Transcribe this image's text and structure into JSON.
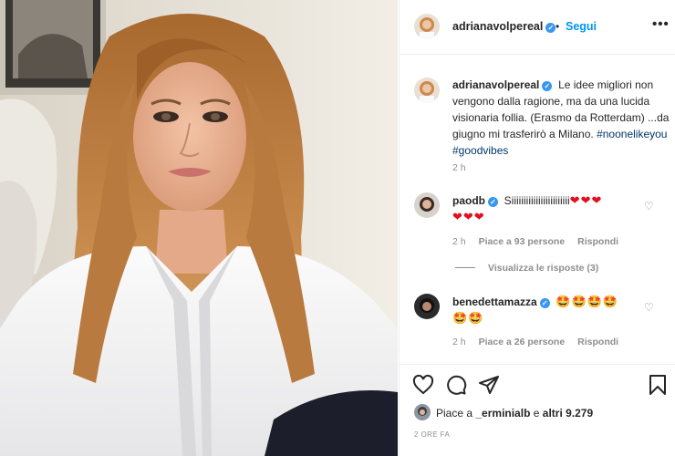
{
  "post": {
    "username": "adrianavolpereal",
    "follow_label": "Segui",
    "dot": "•",
    "more_label": "•••",
    "caption_text": "Le idee migliori non vengono dalla ragione, ma da una lucida visionaria follia. (Erasmo da Rotterdam) ...da giugno mi trasferirò a Milano.",
    "hashtag_1": "#noonelikeyou",
    "hashtag_2": "#goodvibes",
    "caption_time": "2 h"
  },
  "comments": [
    {
      "username": "paodb",
      "text": "Siiiiiiiiiiiiiiiiiiiiiiii",
      "hearts_line1": "❤❤❤",
      "hearts_line2": "❤❤❤",
      "time": "2 h",
      "likes": "Piace a 93 persone",
      "reply": "Rispondi"
    },
    {
      "username": "benedettamazza",
      "emoji_line1": "🤩🤩🤩🤩",
      "emoji_line2": "🤩🤩",
      "time": "2 h",
      "likes": "Piace a 26 persone",
      "reply": "Rispondi"
    }
  ],
  "replies_toggle": "Visualizza le risposte (3)",
  "likes_summary": {
    "prefix": "Piace a",
    "user": "_erminialb",
    "middle": "e",
    "others": "altri 9.279"
  },
  "time_ago": "2 ORE FA",
  "colors": {
    "follow": "#0095f6",
    "verified": "#3897f0",
    "heart_emoji": "#e0101f",
    "muted": "#8e8e8e",
    "hashtag": "#00376b"
  },
  "icons": [
    "heart-icon",
    "comment-icon",
    "share-icon",
    "bookmark-icon",
    "verified-icon",
    "more-icon"
  ]
}
